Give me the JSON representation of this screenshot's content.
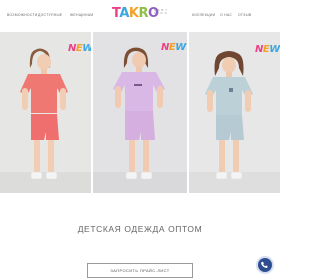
{
  "header": {
    "nav_left": [
      "Возможности",
      "Доступные",
      "Женщинам"
    ],
    "nav_right": [
      "Коллекции",
      "О нас",
      "Отзыв"
    ],
    "logo": {
      "main": [
        "T",
        "A",
        "K",
        "R",
        "O"
      ],
      "side": "B A B Y\nK I D S"
    }
  },
  "gallery": {
    "items": [
      {
        "outfit": "coral t-shirt and shorts",
        "badge": [
          "N",
          "E",
          "W"
        ]
      },
      {
        "outfit": "lilac t-shirt and shorts",
        "badge": [
          "N",
          "E",
          "W"
        ]
      },
      {
        "outfit": "light blue t-shirt and shorts",
        "badge": [
          "N",
          "E",
          "W"
        ]
      }
    ]
  },
  "hero": {
    "title": "ДЕТСКАЯ ОДЕЖДА ОПТОМ",
    "cta_label": "ЗАПРОСИТЬ ПРАЙС-ЛИСТ"
  },
  "fab": {
    "icon": "phone-icon",
    "color": "#2f4e92"
  },
  "colors": {
    "coral": "#f07873",
    "lilac": "#dab8e6",
    "light_blue": "#bcd0d8",
    "brand_pink": "#ee3f86",
    "brand_blue": "#3aa7e0",
    "brand_orange": "#f2a22a",
    "brand_green": "#8fc045",
    "brand_purple": "#8e5fc7"
  }
}
